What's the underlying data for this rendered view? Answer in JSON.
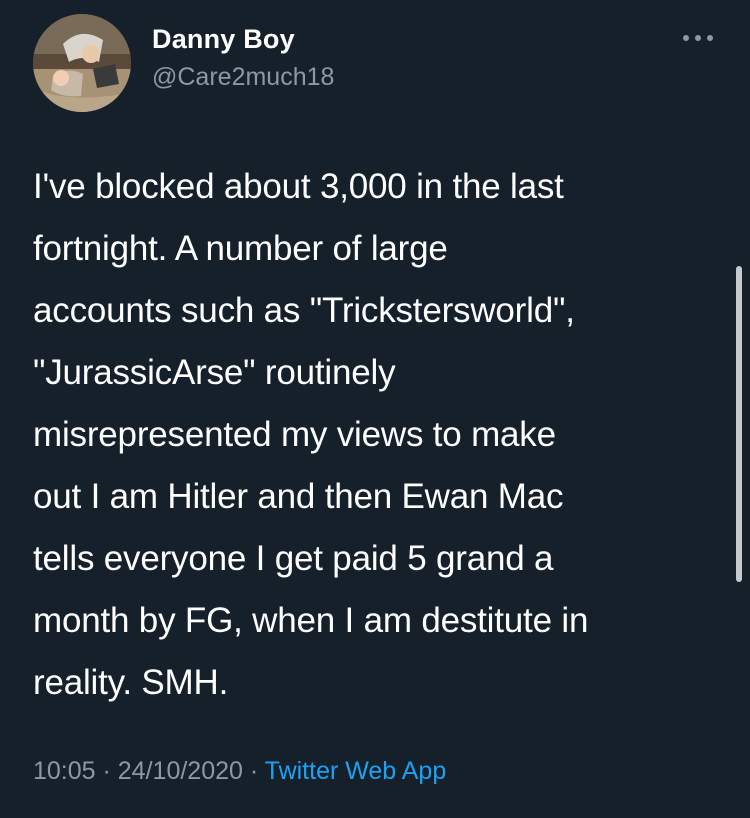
{
  "author": {
    "display_name": "Danny Boy",
    "handle": "@Care2much18",
    "avatar_icon": "profile-photo"
  },
  "menu": {
    "icon": "more-dots-icon"
  },
  "tweet": {
    "lines": [
      "I've blocked about 3,000 in the last",
      "fortnight. A number of large",
      "accounts such as \"Trickstersworld\",",
      "\"JurassicArse\" routinely",
      "misrepresented my views to make",
      "out I am Hitler and then Ewan Mac",
      "tells everyone I get paid 5 grand a",
      "month by FG, when I am destitute in",
      "reality. SMH."
    ]
  },
  "meta": {
    "time": "10:05",
    "separator": " · ",
    "date": "24/10/2020",
    "source": "Twitter Web App"
  },
  "colors": {
    "background": "#15202b",
    "text": "#ffffff",
    "muted": "#8b98a5",
    "link": "#1da1f2"
  }
}
